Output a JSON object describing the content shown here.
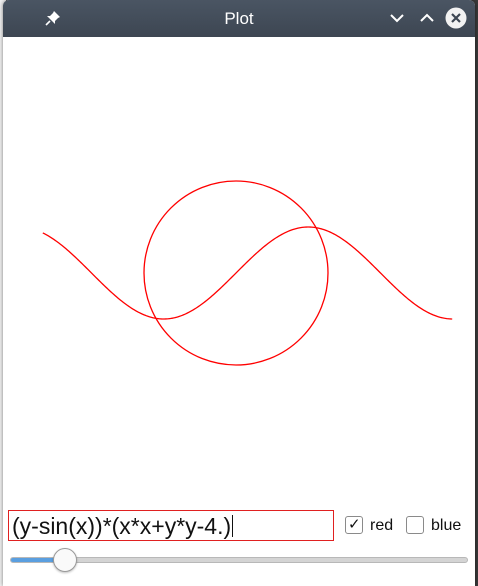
{
  "window": {
    "title": "Plot"
  },
  "titlebar_icons": {
    "pin": "pin-icon",
    "minimize": "chevron-down-icon",
    "maximize": "chevron-up-icon",
    "close": "close-icon"
  },
  "expression": {
    "value": "(y-sin(x))*(x*x+y*y-4.)"
  },
  "checkboxes": {
    "red": {
      "label": "red",
      "checked": true
    },
    "blue": {
      "label": "blue",
      "checked": false
    }
  },
  "slider": {
    "value_fraction": 0.12
  },
  "colors": {
    "curve": "#ff0000",
    "titlebar": "#434c58",
    "accent": "#5a9fe0"
  },
  "chart_data": {
    "type": "line",
    "series": [
      {
        "function": "y = sin(x)",
        "x_range": [
          -4.2,
          4.7
        ]
      },
      {
        "function": "x*x + y*y = 4",
        "center": [
          0,
          0
        ],
        "radius": 2
      }
    ],
    "grid": false,
    "axes_visible": false
  }
}
